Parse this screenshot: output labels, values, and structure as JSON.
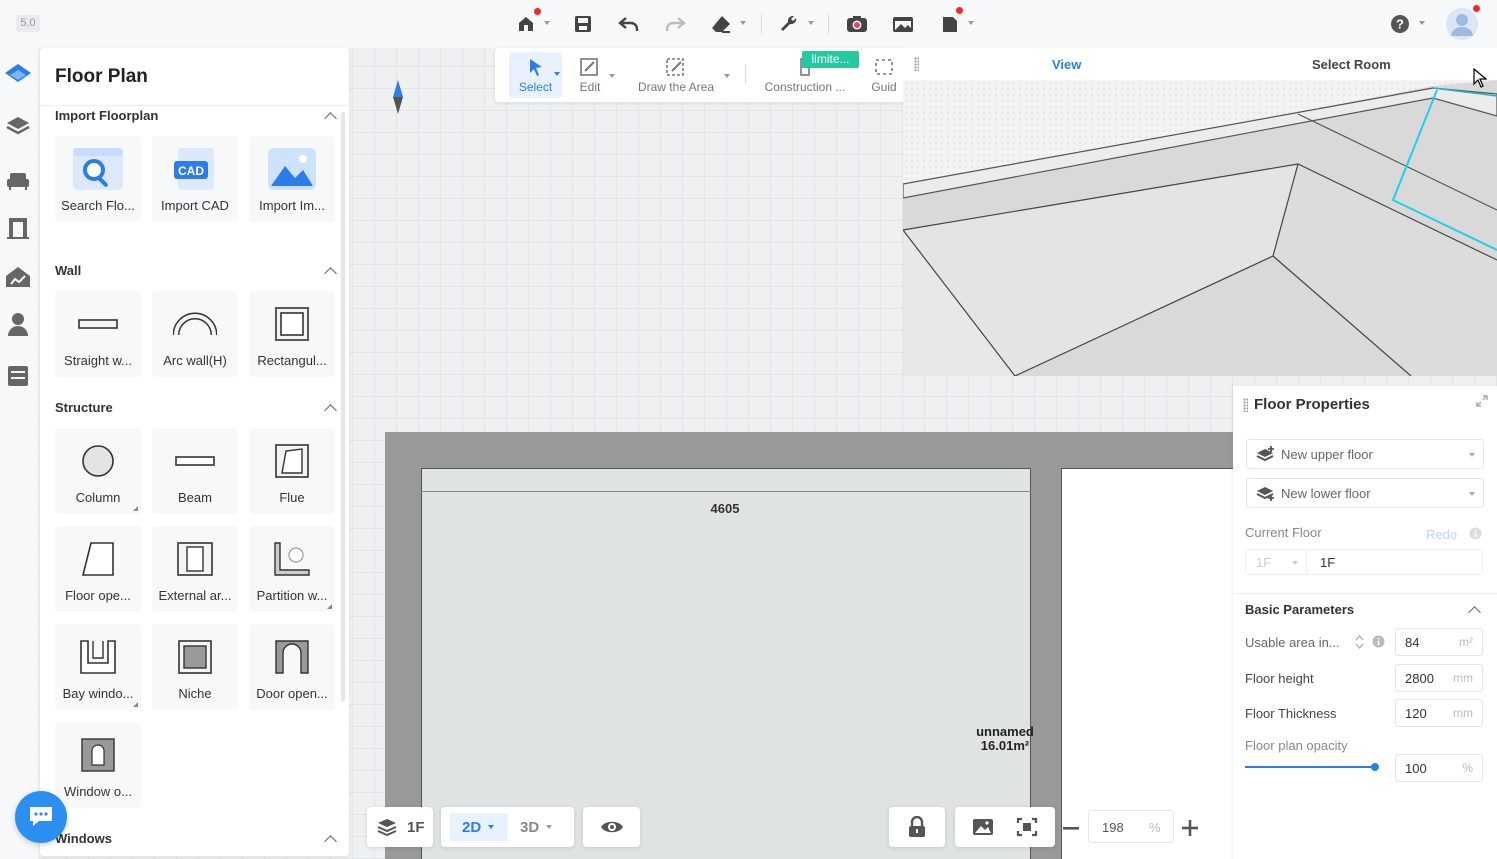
{
  "app": {
    "version": "5.0",
    "accent_color": "#2b7de9",
    "topbar_icons": [
      "home-icon",
      "save-icon",
      "undo-icon",
      "redo-icon",
      "eraser-icon",
      "wrench-icon",
      "camera-icon",
      "gallery-icon",
      "document-icon",
      "help-icon",
      "avatar"
    ]
  },
  "panel": {
    "title": "Floor Plan",
    "sections": [
      {
        "title": "Import Floorplan",
        "items": [
          {
            "label": "Search Flo...",
            "icon": "search-floorplan-icon"
          },
          {
            "label": "Import CAD",
            "icon": "cad-icon",
            "icon_text": "CAD"
          },
          {
            "label": "Import Im...",
            "icon": "image-icon"
          }
        ]
      },
      {
        "title": "Wall",
        "items": [
          {
            "label": "Straight w...",
            "icon": "straight-wall-icon"
          },
          {
            "label": "Arc wall(H)",
            "icon": "arc-wall-icon"
          },
          {
            "label": "Rectangul...",
            "icon": "rectangular-wall-icon"
          }
        ]
      },
      {
        "title": "Structure",
        "items": [
          {
            "label": "Column",
            "icon": "column-icon"
          },
          {
            "label": "Beam",
            "icon": "beam-icon"
          },
          {
            "label": "Flue",
            "icon": "flue-icon"
          },
          {
            "label": "Floor ope...",
            "icon": "floor-opening-icon"
          },
          {
            "label": "External ar...",
            "icon": "external-area-icon"
          },
          {
            "label": "Partition w...",
            "icon": "partition-wall-icon"
          },
          {
            "label": "Bay windo...",
            "icon": "bay-window-icon"
          },
          {
            "label": "Niche",
            "icon": "niche-icon"
          },
          {
            "label": "Door open...",
            "icon": "door-opening-icon"
          },
          {
            "label": "Window o...",
            "icon": "window-opening-icon"
          }
        ]
      },
      {
        "title": "Windows",
        "items": []
      }
    ]
  },
  "toolbar": {
    "tools": [
      {
        "label": "Select",
        "icon": "cursor-icon"
      },
      {
        "label": "Edit",
        "icon": "edit-icon"
      },
      {
        "label": "Draw the Area",
        "icon": "draw-area-icon"
      },
      {
        "label": "Construction ...",
        "icon": "construction-icon"
      },
      {
        "label": "Guid",
        "icon": "guide-icon"
      }
    ],
    "limited_badge": "limite..."
  },
  "view3d": {
    "tab_view": "View",
    "tab_select_room": "Select Room"
  },
  "canvas": {
    "dimension": "4605",
    "room_name": "unnamed",
    "room_area": "16.01m²"
  },
  "properties": {
    "title": "Floor Properties",
    "new_upper_floor": "New upper floor",
    "new_lower_floor": "New lower floor",
    "current_floor_label": "Current Floor",
    "redo_label": "Redo",
    "floor_select": "1F",
    "floor_name": "1F",
    "basic_params_title": "Basic Parameters",
    "usable_area_label": "Usable area in...",
    "usable_area_value": "84",
    "usable_area_unit": "m²",
    "floor_height_label": "Floor height",
    "floor_height_value": "2800",
    "floor_height_unit": "mm",
    "floor_thickness_label": "Floor Thickness",
    "floor_thickness_value": "120",
    "floor_thickness_unit": "mm",
    "opacity_label": "Floor plan opacity",
    "opacity_value": "100",
    "opacity_unit": "%",
    "opacity_fraction": 1.0
  },
  "bottom": {
    "floor": "1F",
    "mode_2d": "2D",
    "mode_3d": "3D",
    "zoom_value": "198",
    "zoom_unit": "%"
  }
}
